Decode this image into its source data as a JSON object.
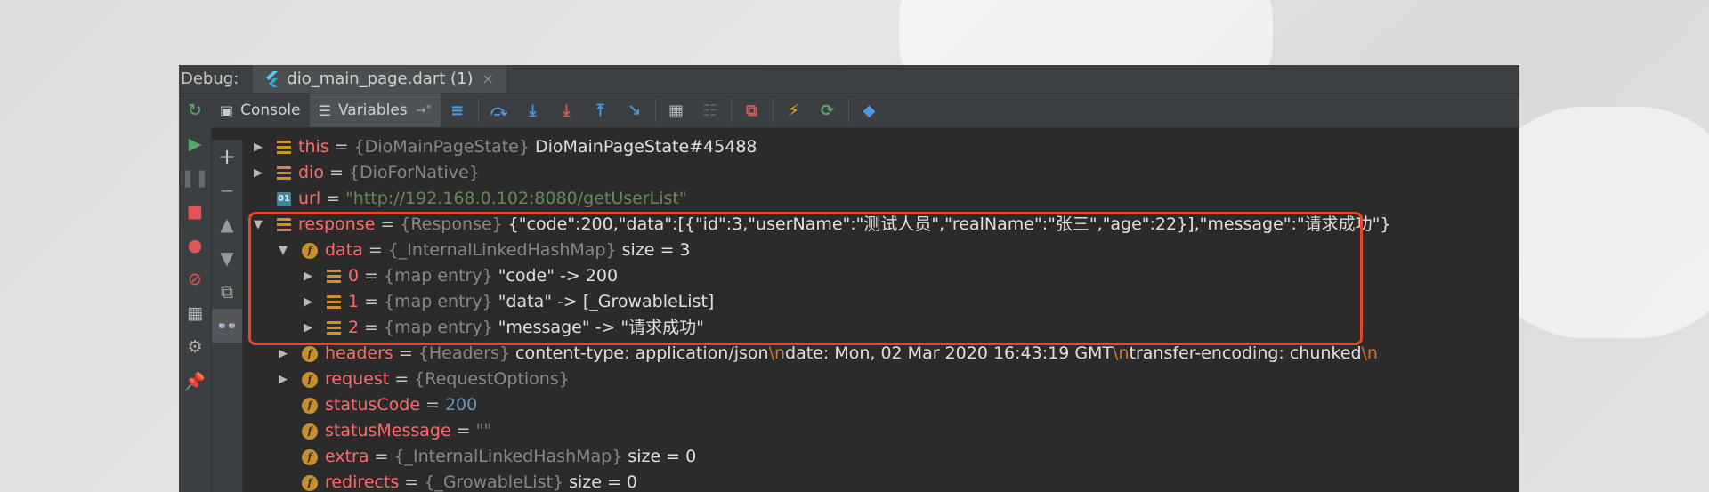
{
  "tabbar": {
    "debug_label": "Debug:",
    "file_tab": "dio_main_page.dart (1)",
    "close_glyph": "×"
  },
  "toolbar": {
    "console_label": "Console",
    "variables_label": "Variables",
    "variables_pin": "→\""
  },
  "accent": {
    "highlight": "#e8452a",
    "name": "#ff6b68",
    "string": "#6a8759",
    "number": "#6897bb"
  },
  "rows": [
    {
      "name": "this",
      "type": "{DioMainPageState}",
      "value": "DioMainPageState#45488"
    },
    {
      "name": "dio",
      "type": "{DioForNative}",
      "value": ""
    },
    {
      "name": "url",
      "icon_text": "01",
      "string": "\"http://192.168.0.102:8080/getUserList\""
    },
    {
      "name": "response",
      "type": "{Response}",
      "value": "{\"code\":200,\"data\":[{\"id\":3,\"userName\":\"测试人员\",\"realName\":\"张三\",\"age\":22}],\"message\":\"请求成功\"}"
    },
    {
      "name": "data",
      "type": "{_InternalLinkedHashMap}",
      "value": "size = 3"
    },
    {
      "name": "0",
      "type": "{map entry}",
      "value": "\"code\" -> 200"
    },
    {
      "name": "1",
      "type": "{map entry}",
      "value": "\"data\" -> [_GrowableList]"
    },
    {
      "name": "2",
      "type": "{map entry}",
      "value": "\"message\" -> \"请求成功\""
    },
    {
      "name": "headers",
      "type": "{Headers}",
      "value_parts": [
        "content-type: application/json",
        "\\n",
        "date: Mon, 02 Mar 2020 16:43:19 GMT",
        "\\n",
        "transfer-encoding: chunked",
        "\\n"
      ]
    },
    {
      "name": "request",
      "type": "{RequestOptions}",
      "value": ""
    },
    {
      "name": "statusCode",
      "number": "200"
    },
    {
      "name": "statusMessage",
      "string": "\"\""
    },
    {
      "name": "extra",
      "type": "{_InternalLinkedHashMap}",
      "value": "size = 0"
    },
    {
      "name": "redirects",
      "type": "{_GrowableList}",
      "value": "size = 0"
    }
  ],
  "common": {
    "eq": "="
  }
}
